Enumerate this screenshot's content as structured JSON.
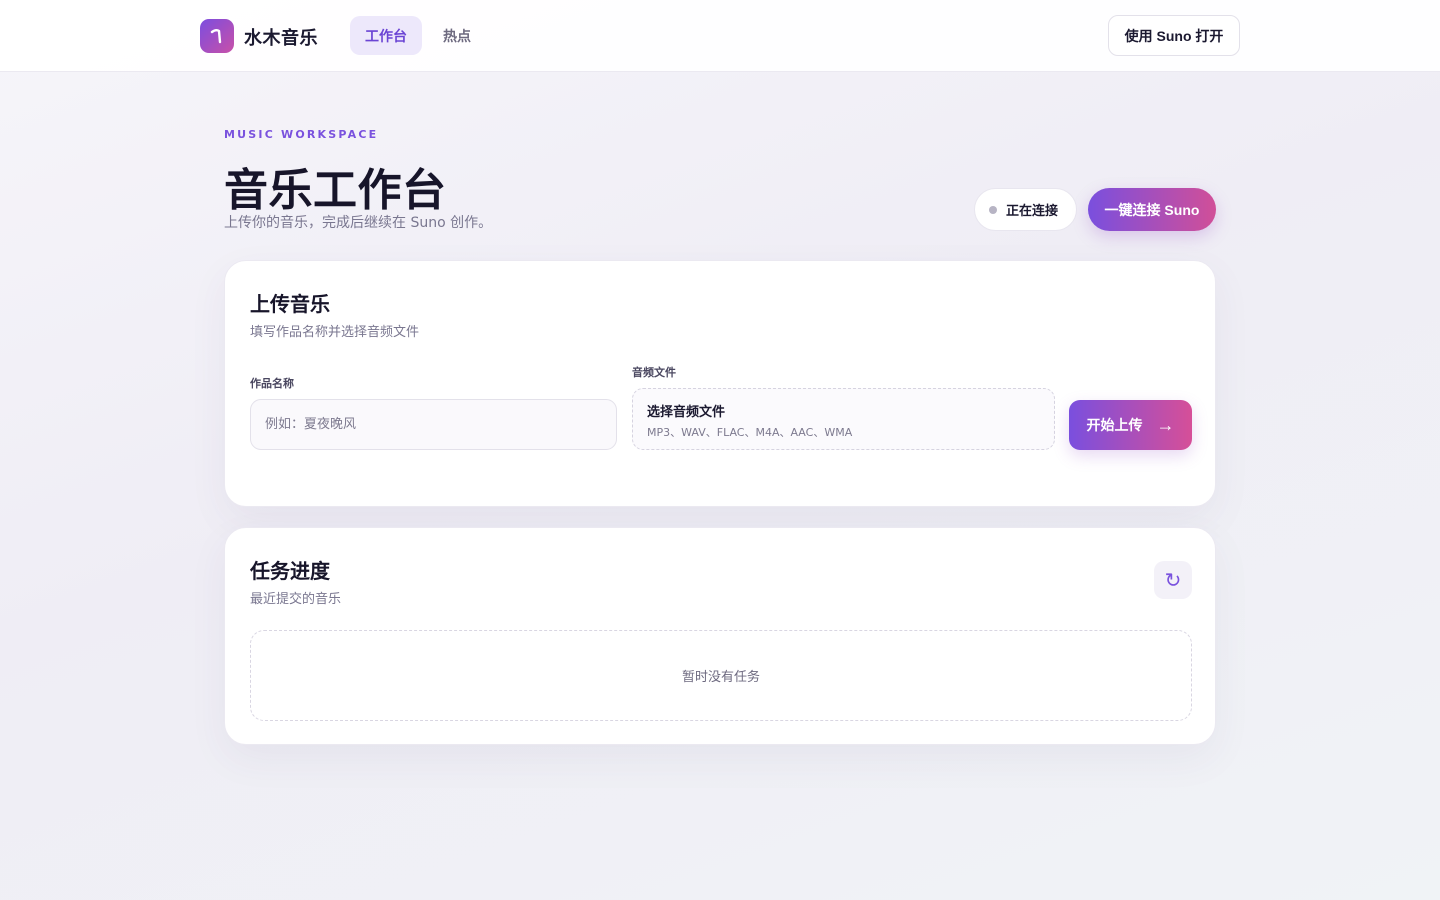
{
  "header": {
    "app_name": "水木音乐",
    "tabs": [
      {
        "label": "工作台",
        "active": true
      },
      {
        "label": "热点",
        "active": false
      }
    ],
    "open_suno_label": "使用 Suno 打开"
  },
  "hero": {
    "eyebrow": "MUSIC WORKSPACE",
    "title": "音乐工作台",
    "subtitle": "上传你的音乐，完成后继续在 Suno 创作。",
    "status_label": "正在连接",
    "connect_label": "一键连接 Suno"
  },
  "upload_card": {
    "title": "上传音乐",
    "subtitle": "填写作品名称并选择音频文件",
    "name_label": "作品名称",
    "name_placeholder": "例如：夏夜晚风",
    "name_value": "",
    "file_label": "音频文件",
    "file_title": "选择音频文件",
    "file_formats": "MP3、WAV、FLAC、M4A、AAC、WMA",
    "submit_label": "开始上传",
    "submit_arrow": "→"
  },
  "tasks_card": {
    "title": "任务进度",
    "subtitle": "最近提交的音乐",
    "refresh_icon": "↻",
    "empty_text": "暂时没有任务"
  },
  "colors": {
    "accent": "#7a52de",
    "gradient_start": "#7a4fde",
    "gradient_end": "#d14f98",
    "status_dot": "#b7b4c4"
  }
}
